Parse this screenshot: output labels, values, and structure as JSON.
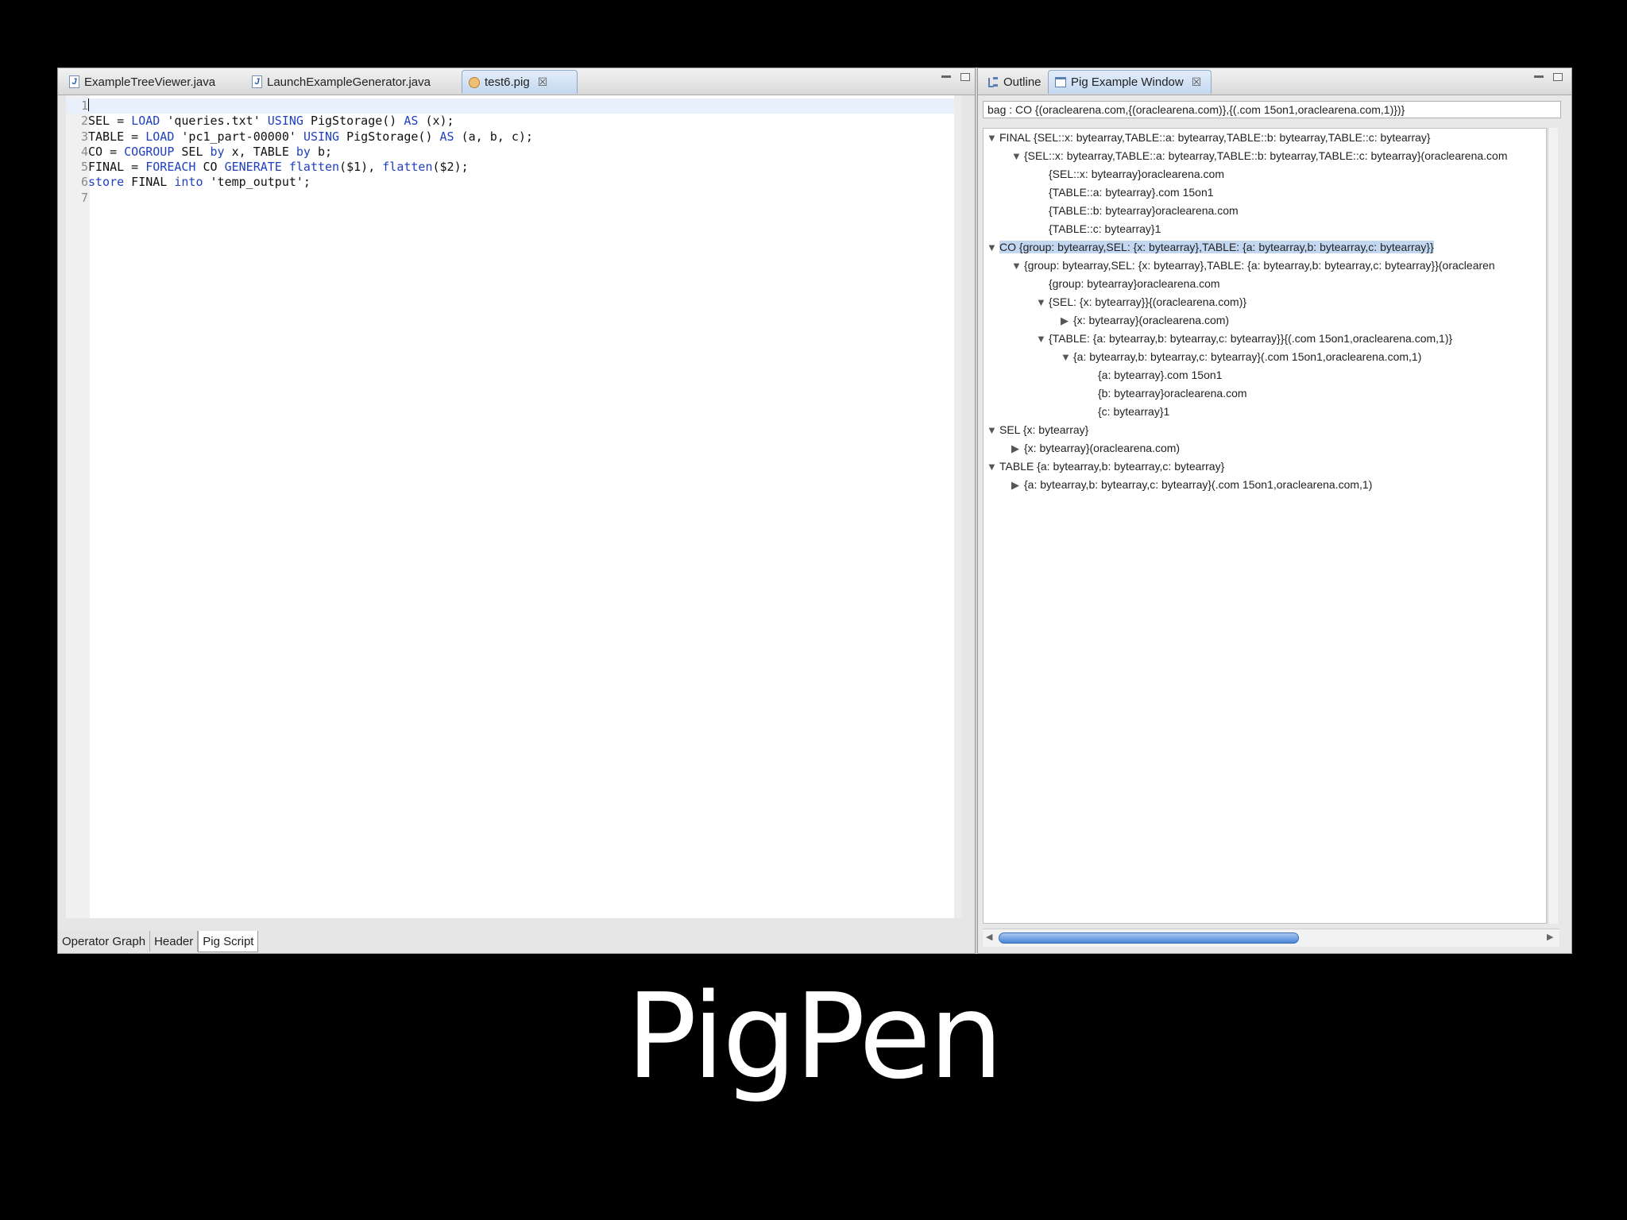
{
  "editor": {
    "tabs": [
      {
        "label": "ExampleTreeViewer.java",
        "icon": "java-file-icon"
      },
      {
        "label": "LaunchExampleGenerator.java",
        "icon": "java-file-icon"
      },
      {
        "label": "test6.pig",
        "icon": "pig-file-icon",
        "active": true
      }
    ],
    "close_glyph": "☒",
    "line_numbers": [
      "1",
      "2",
      "3",
      "4",
      "5",
      "6",
      "7"
    ],
    "bottom_tabs": [
      "Operator Graph",
      "Header",
      "Pig Script"
    ],
    "active_bottom_tab": "Pig Script"
  },
  "code": {
    "line2": {
      "a": "SEL = ",
      "b": "LOAD",
      "c": " 'queries.txt' ",
      "d": "USING",
      "e": " PigStorage() ",
      "f": "AS",
      "g": " (x);"
    },
    "line3": {
      "a": "TABLE = ",
      "b": "LOAD",
      "c": " 'pc1_part-00000' ",
      "d": "USING",
      "e": " PigStorage() ",
      "f": "AS",
      "g": " (a, b, c);"
    },
    "line4": {
      "a": "CO = ",
      "b": "COGROUP",
      "c": " SEL ",
      "d": "by",
      "e": " x, TABLE ",
      "f": "by",
      "g": " b;"
    },
    "line5": {
      "a": "FINAL = ",
      "b": "FOREACH",
      "c": " CO ",
      "d": "GENERATE",
      "e": " ",
      "f": "flatten",
      "g": "($1), ",
      "h": "flatten",
      "i": "($2);"
    },
    "line6": {
      "a": "store",
      "b": " FINAL ",
      "c": "into",
      "d": " 'temp_output';"
    }
  },
  "right_panel": {
    "tabs": [
      {
        "label": "Outline",
        "icon": "outline-icon"
      },
      {
        "label": "Pig Example Window",
        "icon": "window-icon",
        "active": true
      }
    ],
    "bag_text": "bag : CO {(oraclearena.com,{(oraclearena.com)},{(.com 15on1,oraclearena.com,1)})}",
    "tree": [
      {
        "text": "FINAL {SEL::x: bytearray,TABLE::a: bytearray,TABLE::b: bytearray,TABLE::c: bytearray}",
        "twisty": "▼"
      },
      {
        "text": "{SEL::x: bytearray,TABLE::a: bytearray,TABLE::b: bytearray,TABLE::c: bytearray}(oraclearena.com",
        "twisty": "▼"
      },
      {
        "text": "{SEL::x: bytearray}oraclearena.com",
        "twisty": ""
      },
      {
        "text": "{TABLE::a: bytearray}.com 15on1",
        "twisty": ""
      },
      {
        "text": "{TABLE::b: bytearray}oraclearena.com",
        "twisty": ""
      },
      {
        "text": "{TABLE::c: bytearray}1",
        "twisty": ""
      },
      {
        "text": "CO {group: bytearray,SEL: {x: bytearray},TABLE: {a: bytearray,b: bytearray,c: bytearray}}",
        "twisty": "▼",
        "selected": true
      },
      {
        "text": "{group: bytearray,SEL: {x: bytearray},TABLE: {a: bytearray,b: bytearray,c: bytearray}}(oraclearen",
        "twisty": "▼"
      },
      {
        "text": "{group: bytearray}oraclearena.com",
        "twisty": ""
      },
      {
        "text": "{SEL: {x: bytearray}}{(oraclearena.com)}",
        "twisty": "▼"
      },
      {
        "text": "{x: bytearray}(oraclearena.com)",
        "twisty": "▶"
      },
      {
        "text": "{TABLE: {a: bytearray,b: bytearray,c: bytearray}}{(.com 15on1,oraclearena.com,1)}",
        "twisty": "▼"
      },
      {
        "text": "{a: bytearray,b: bytearray,c: bytearray}(.com 15on1,oraclearena.com,1)",
        "twisty": "▼"
      },
      {
        "text": "{a: bytearray}.com 15on1",
        "twisty": ""
      },
      {
        "text": "{b: bytearray}oraclearena.com",
        "twisty": ""
      },
      {
        "text": "{c: bytearray}1",
        "twisty": ""
      },
      {
        "text": "SEL {x: bytearray}",
        "twisty": "▼"
      },
      {
        "text": "{x: bytearray}(oraclearena.com)",
        "twisty": "▶"
      },
      {
        "text": "TABLE {a: bytearray,b: bytearray,c: bytearray}",
        "twisty": "▼"
      },
      {
        "text": "{a: bytearray,b: bytearray,c: bytearray}(.com 15on1,oraclearena.com,1)",
        "twisty": "▶"
      }
    ],
    "scroll_left_glyph": "◀",
    "scroll_right_glyph": "▶"
  },
  "caption": "PigPen"
}
